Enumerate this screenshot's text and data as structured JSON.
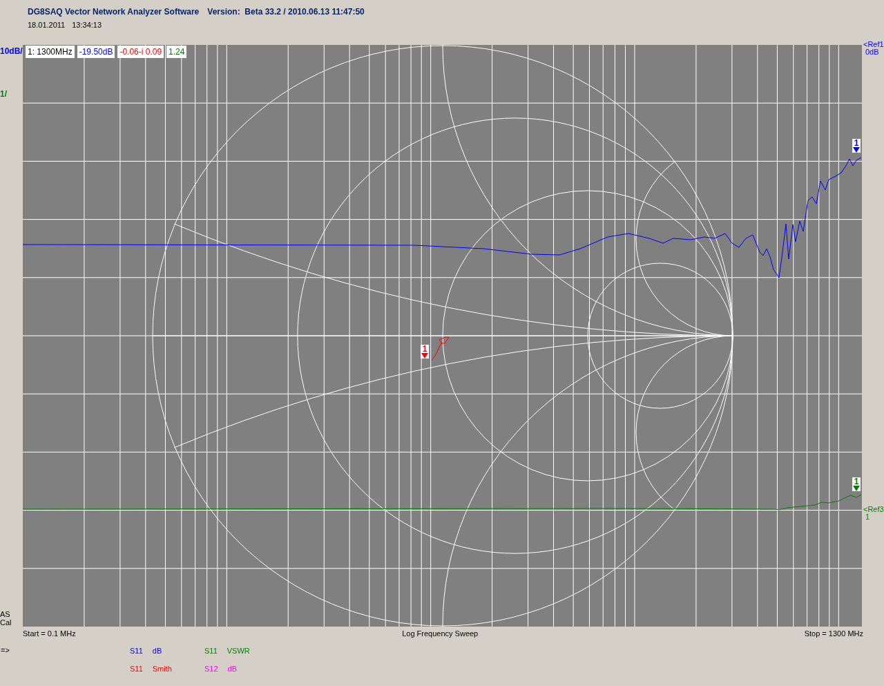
{
  "window": {
    "title": "DG8SAQ Vector Network Analyzer Software",
    "version": "Version:  Beta 33.2 / 2010.06.13 11:47:50"
  },
  "timestamp": {
    "date": "18.01.2011",
    "time": "13:34:13"
  },
  "scale_labels": [
    {
      "text": "10dB/",
      "color": "#0000ff"
    },
    {
      "text": "1/",
      "color": "#008000"
    }
  ],
  "marker_readout": [
    {
      "text": "1: 1300MHz",
      "color": "#000000"
    },
    {
      "text": "-19.50dB",
      "color": "#0000ff"
    },
    {
      "text": "-0.06-i 0.09",
      "color": "#ff0000"
    },
    {
      "text": "1.24",
      "color": "#008000"
    }
  ],
  "ref_labels": [
    {
      "name": "<Ref1",
      "value": "0dB",
      "color": "#0000ff"
    },
    {
      "name": "<Ref3",
      "value": "1",
      "color": "#008000"
    }
  ],
  "markers": [
    {
      "label": "1",
      "color": "#0000ff"
    },
    {
      "label": "1",
      "color": "#ff0000"
    },
    {
      "label": "1",
      "color": "#008000"
    }
  ],
  "cal_status": [
    "AS",
    "Cal"
  ],
  "axis": {
    "start": "Start = 0.1 MHz",
    "sweep_mode": "Log Frequency Sweep",
    "stop": "Stop = 1300 MHz"
  },
  "prompt": "=>",
  "legend": [
    {
      "parameter": "S11",
      "format": "dB",
      "color": "#0000ff"
    },
    {
      "parameter": "S11",
      "format": "VSWR",
      "color": "#008000"
    },
    {
      "parameter": "S11",
      "format": "Smith",
      "color": "#ff0000"
    },
    {
      "parameter": "S12",
      "format": "dB",
      "color": "#ff00ff"
    }
  ]
}
